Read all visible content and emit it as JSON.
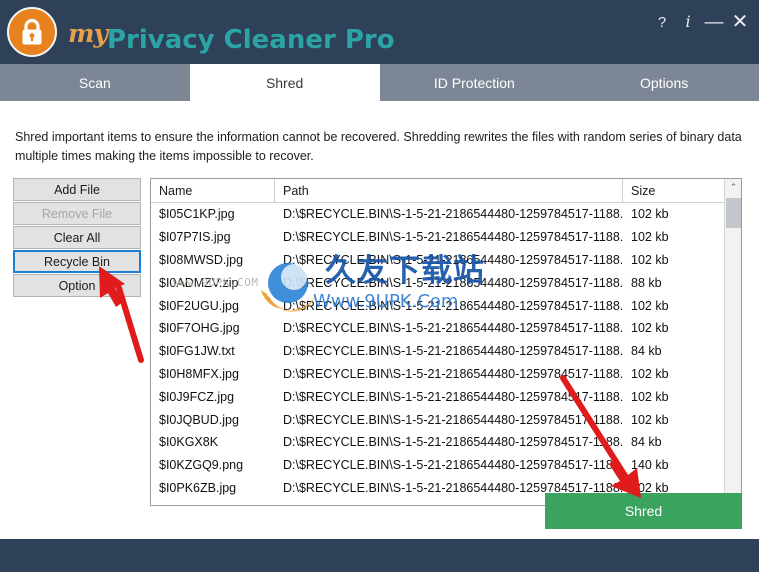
{
  "window": {
    "brand_my": "my",
    "brand_main": "Privacy Cleaner Pro",
    "buttons": {
      "help": "?",
      "info": "i",
      "minimize": "—",
      "close": "✕"
    }
  },
  "tabs": [
    {
      "label": "Scan",
      "active": false
    },
    {
      "label": "Shred",
      "active": true
    },
    {
      "label": "ID Protection",
      "active": false
    },
    {
      "label": "Options",
      "active": false
    }
  ],
  "description": "Shred important items to ensure the information cannot be recovered. Shredding rewrites the files with random series of binary data multiple times making the items impossible to recover.",
  "side_buttons": [
    {
      "label": "Add File",
      "state": "normal"
    },
    {
      "label": "Remove File",
      "state": "disabled"
    },
    {
      "label": "Clear All",
      "state": "normal"
    },
    {
      "label": "Recycle Bin",
      "state": "focused"
    },
    {
      "label": "Option",
      "state": "normal"
    }
  ],
  "file_list": {
    "columns": [
      "Name",
      "Path",
      "Size"
    ],
    "rows": [
      {
        "name": "$I05C1KP.jpg",
        "path": "D:\\$RECYCLE.BIN\\S-1-5-21-2186544480-1259784517-1188...",
        "size": "102 kb"
      },
      {
        "name": "$I07P7IS.jpg",
        "path": "D:\\$RECYCLE.BIN\\S-1-5-21-2186544480-1259784517-1188...",
        "size": "102 kb"
      },
      {
        "name": "$I08MWSD.jpg",
        "path": "D:\\$RECYCLE.BIN\\S-1-5-21-2186544480-1259784517-1188...",
        "size": "102 kb"
      },
      {
        "name": "$I0ADMZV.zip",
        "path": "D:\\$RECYCLE.BIN\\S-1-5-21-2186544480-1259784517-1188...",
        "size": "88 kb"
      },
      {
        "name": "$I0F2UGU.jpg",
        "path": "D:\\$RECYCLE.BIN\\S-1-5-21-2186544480-1259784517-1188...",
        "size": "102 kb"
      },
      {
        "name": "$I0F7OHG.jpg",
        "path": "D:\\$RECYCLE.BIN\\S-1-5-21-2186544480-1259784517-1188...",
        "size": "102 kb"
      },
      {
        "name": "$I0FG1JW.txt",
        "path": "D:\\$RECYCLE.BIN\\S-1-5-21-2186544480-1259784517-1188...",
        "size": "84 kb"
      },
      {
        "name": "$I0H8MFX.jpg",
        "path": "D:\\$RECYCLE.BIN\\S-1-5-21-2186544480-1259784517-1188...",
        "size": "102 kb"
      },
      {
        "name": "$I0J9FCZ.jpg",
        "path": "D:\\$RECYCLE.BIN\\S-1-5-21-2186544480-1259784517-1188...",
        "size": "102 kb"
      },
      {
        "name": "$I0JQBUD.jpg",
        "path": "D:\\$RECYCLE.BIN\\S-1-5-21-2186544480-1259784517-1188...",
        "size": "102 kb"
      },
      {
        "name": "$I0KGX8K",
        "path": "D:\\$RECYCLE.BIN\\S-1-5-21-2186544480-1259784517-1188...",
        "size": "84 kb"
      },
      {
        "name": "$I0KZGQ9.png",
        "path": "D:\\$RECYCLE.BIN\\S-1-5-21-2186544480-1259784517-1188...",
        "size": "140 kb"
      },
      {
        "name": "$I0PK6ZB.jpg",
        "path": "D:\\$RECYCLE.BIN\\S-1-5-21-2186544480-1259784517-1188...",
        "size": "102 kb"
      }
    ],
    "scrollbar": {
      "up_arrow": "⌃",
      "down_arrow": "⌄"
    }
  },
  "shred_button": {
    "label": "Shred"
  },
  "watermark": {
    "left_text": "www.9UPK.COM",
    "chinese": "久友下载站",
    "url": "Www.9UPK.Com"
  },
  "colors": {
    "header_navy": "#2f4059",
    "tabbar_gray": "#7d8695",
    "logo_orange": "#e8821e",
    "brand_teal": "#2aa4a4",
    "shred_green": "#3aa35f",
    "focus_blue": "#1a7fd4",
    "arrow_red": "#e01b1b"
  }
}
